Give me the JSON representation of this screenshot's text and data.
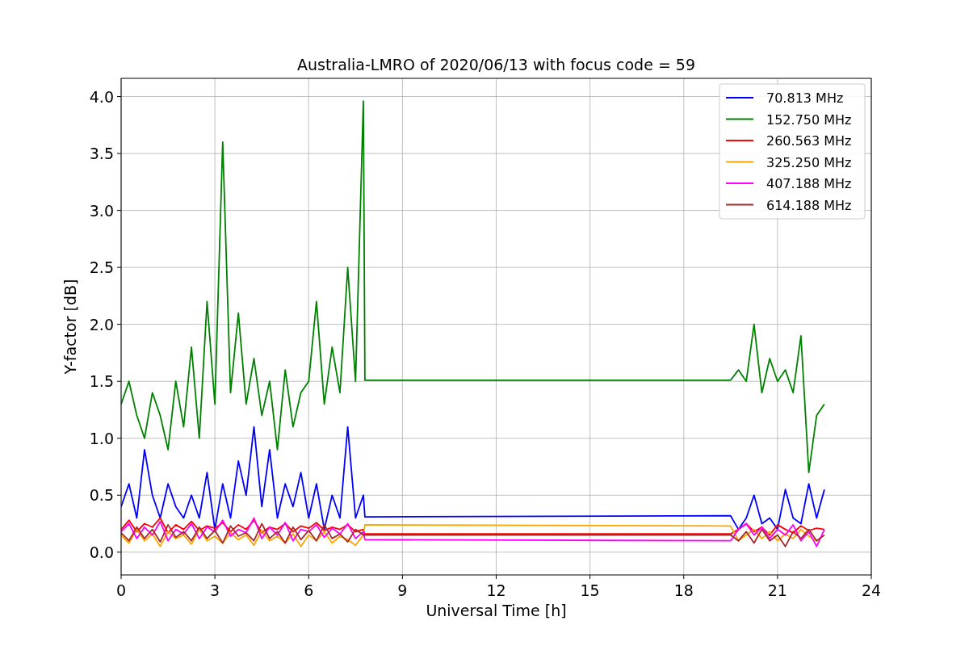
{
  "chart_data": {
    "type": "line",
    "title": "Australia-LMRO of 2020/06/13 with focus code = 59",
    "xlabel": "Universal Time [h]",
    "ylabel": "Y-factor [dB]",
    "x": [
      0,
      0.25,
      0.5,
      0.75,
      1,
      1.25,
      1.5,
      1.75,
      2,
      2.25,
      2.5,
      2.75,
      3,
      3.25,
      3.5,
      3.75,
      4,
      4.25,
      4.5,
      4.75,
      5,
      5.25,
      5.5,
      5.75,
      6,
      6.25,
      6.5,
      6.75,
      7,
      7.25,
      7.5,
      7.75,
      7.8,
      19.5,
      19.75,
      20,
      20.25,
      20.5,
      20.75,
      21,
      21.25,
      21.5,
      21.75,
      22,
      22.25,
      22.5
    ],
    "grid": true,
    "legend": true,
    "xlim": [
      0,
      24
    ],
    "ylim": [
      -0.2,
      4.16
    ],
    "xticks": [
      0,
      3,
      6,
      9,
      12,
      15,
      18,
      21,
      24
    ],
    "yticks": [
      {
        "value": 0,
        "label": "0.0"
      },
      {
        "value": 0.5,
        "label": "0.5"
      },
      {
        "value": 1,
        "label": "1.0"
      },
      {
        "value": 1.5,
        "label": "1.5"
      },
      {
        "value": 2,
        "label": "2.0"
      },
      {
        "value": 2.5,
        "label": "2.5"
      },
      {
        "value": 3,
        "label": "3.0"
      },
      {
        "value": 3.5,
        "label": "3.5"
      },
      {
        "value": 4,
        "label": "4.0"
      }
    ],
    "series": [
      {
        "name": "70.813 MHz",
        "color": "#0000ff",
        "values": [
          0.4,
          0.6,
          0.3,
          0.9,
          0.5,
          0.3,
          0.6,
          0.4,
          0.3,
          0.5,
          0.3,
          0.7,
          0.2,
          0.6,
          0.3,
          0.8,
          0.5,
          1.1,
          0.4,
          0.9,
          0.3,
          0.6,
          0.4,
          0.7,
          0.3,
          0.6,
          0.2,
          0.5,
          0.3,
          1.1,
          0.3,
          0.5,
          0.31,
          0.32,
          0.2,
          0.3,
          0.5,
          0.25,
          0.3,
          0.2,
          0.55,
          0.3,
          0.25,
          0.6,
          0.3,
          0.55
        ]
      },
      {
        "name": "152.750 MHz",
        "color": "#008000",
        "values": [
          1.3,
          1.5,
          1.2,
          1.0,
          1.4,
          1.2,
          0.9,
          1.5,
          1.1,
          1.8,
          1.0,
          2.2,
          1.3,
          3.6,
          1.4,
          2.1,
          1.3,
          1.7,
          1.2,
          1.5,
          0.9,
          1.6,
          1.1,
          1.4,
          1.5,
          2.2,
          1.3,
          1.8,
          1.4,
          2.5,
          1.5,
          3.96,
          1.51,
          1.51,
          1.6,
          1.5,
          2.0,
          1.4,
          1.7,
          1.5,
          1.6,
          1.4,
          1.9,
          0.7,
          1.2,
          1.3
        ]
      },
      {
        "name": "260.563 MHz",
        "color": "#ff0000",
        "values": [
          0.2,
          0.28,
          0.18,
          0.25,
          0.22,
          0.3,
          0.17,
          0.24,
          0.2,
          0.27,
          0.19,
          0.23,
          0.21,
          0.26,
          0.18,
          0.24,
          0.2,
          0.28,
          0.17,
          0.22,
          0.2,
          0.25,
          0.18,
          0.23,
          0.21,
          0.26,
          0.19,
          0.22,
          0.2,
          0.24,
          0.18,
          0.2,
          0.16,
          0.16,
          0.2,
          0.25,
          0.18,
          0.22,
          0.15,
          0.24,
          0.2,
          0.17,
          0.23,
          0.19,
          0.21,
          0.2
        ]
      },
      {
        "name": "325.250 MHz",
        "color": "#ffa500",
        "values": [
          0.15,
          0.08,
          0.2,
          0.1,
          0.16,
          0.05,
          0.18,
          0.12,
          0.15,
          0.07,
          0.2,
          0.1,
          0.14,
          0.08,
          0.17,
          0.11,
          0.15,
          0.06,
          0.19,
          0.1,
          0.14,
          0.08,
          0.16,
          0.05,
          0.15,
          0.1,
          0.18,
          0.08,
          0.14,
          0.11,
          0.06,
          0.15,
          0.24,
          0.23,
          0.1,
          0.15,
          0.2,
          0.12,
          0.18,
          0.1,
          0.16,
          0.12,
          0.2,
          0.14,
          0.1,
          0.15
        ]
      },
      {
        "name": "407.188 MHz",
        "color": "#ff00ff",
        "values": [
          0.18,
          0.25,
          0.12,
          0.22,
          0.15,
          0.27,
          0.1,
          0.2,
          0.16,
          0.25,
          0.12,
          0.22,
          0.18,
          0.28,
          0.14,
          0.2,
          0.17,
          0.3,
          0.12,
          0.22,
          0.15,
          0.26,
          0.1,
          0.2,
          0.18,
          0.24,
          0.13,
          0.21,
          0.16,
          0.25,
          0.12,
          0.18,
          0.11,
          0.1,
          0.2,
          0.25,
          0.15,
          0.22,
          0.12,
          0.2,
          0.15,
          0.24,
          0.1,
          0.18,
          0.05,
          0.2
        ]
      },
      {
        "name": "614.188 MHz",
        "color": "#a52a2a",
        "values": [
          0.17,
          0.1,
          0.22,
          0.12,
          0.2,
          0.09,
          0.24,
          0.13,
          0.18,
          0.1,
          0.22,
          0.12,
          0.19,
          0.08,
          0.23,
          0.14,
          0.17,
          0.1,
          0.25,
          0.12,
          0.18,
          0.08,
          0.22,
          0.11,
          0.19,
          0.1,
          0.24,
          0.12,
          0.16,
          0.09,
          0.2,
          0.15,
          0.15,
          0.15,
          0.1,
          0.18,
          0.08,
          0.2,
          0.1,
          0.15,
          0.05,
          0.18,
          0.12,
          0.2,
          0.1,
          0.15
        ]
      }
    ]
  }
}
